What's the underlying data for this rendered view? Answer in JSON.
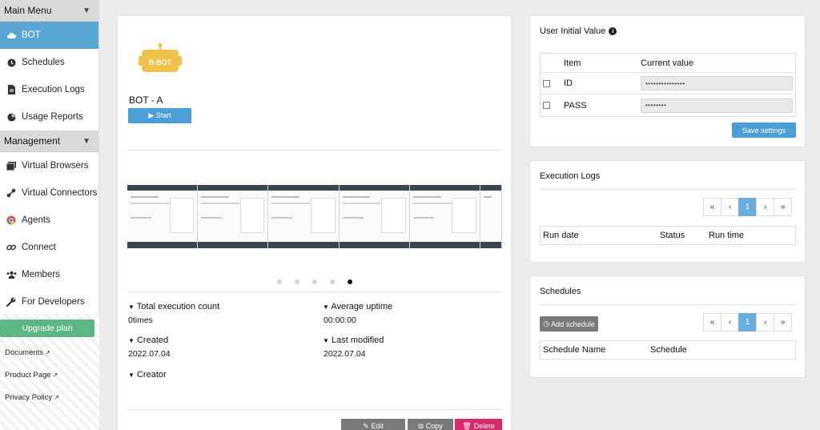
{
  "sidebar": {
    "main_menu_label": "Main Menu",
    "management_label": "Management",
    "main_items": [
      {
        "label": "BOT",
        "icon": "cloud-icon"
      },
      {
        "label": "Schedules",
        "icon": "clock-icon"
      },
      {
        "label": "Execution Logs",
        "icon": "file-icon"
      },
      {
        "label": "Usage Reports",
        "icon": "chart-icon"
      }
    ],
    "management_items": [
      {
        "label": "Virtual Browsers",
        "icon": "browser-icon"
      },
      {
        "label": "Virtual Connectors",
        "icon": "plug-icon"
      },
      {
        "label": "Agents",
        "icon": "chrome-icon"
      },
      {
        "label": "Connect",
        "icon": "link-icon"
      },
      {
        "label": "Members",
        "icon": "users-icon"
      },
      {
        "label": "For Developers",
        "icon": "wrench-icon"
      }
    ],
    "upgrade_label": "Upgrade plan",
    "links": [
      "Documents",
      "Product Page",
      "Privacy Policy"
    ]
  },
  "bot": {
    "logo_text": "B·BOT",
    "name": "BOT - A",
    "start_label": "▶ Start",
    "carousel_active_index": 4,
    "carousel_count": 5,
    "stats": {
      "total_exec_label": "Total execution count",
      "total_exec_value": "0times",
      "avg_uptime_label": "Average uptime",
      "avg_uptime_value": "00:00:00",
      "created_label": "Created",
      "created_value": "2022.07.04",
      "modified_label": "Last modified",
      "modified_value": "2022.07.04",
      "creator_label": "Creator"
    },
    "actions": {
      "edit": "Edit",
      "copy": "Copy",
      "delete": "Delete"
    }
  },
  "user_initial": {
    "title": "User Initial Value",
    "col_item": "Item",
    "col_value": "Current value",
    "rows": [
      {
        "item": "ID",
        "value": "•••••••••••••••"
      },
      {
        "item": "PASS",
        "value": "••••••••"
      }
    ],
    "save_label": "Save settings"
  },
  "exec_logs": {
    "title": "Execution Logs",
    "cols": [
      "Run date",
      "Status",
      "Run time"
    ],
    "page": "1"
  },
  "schedules": {
    "title": "Schedules",
    "add_label": "Add schedule",
    "cols": [
      "Schedule Name",
      "Schedule"
    ],
    "page": "1"
  },
  "colors": {
    "accent": "#5aa6d6",
    "upgrade": "#5cb784",
    "delete": "#d6286b",
    "edit": "#7a7a7a",
    "bot_logo": "#f0c14b"
  }
}
